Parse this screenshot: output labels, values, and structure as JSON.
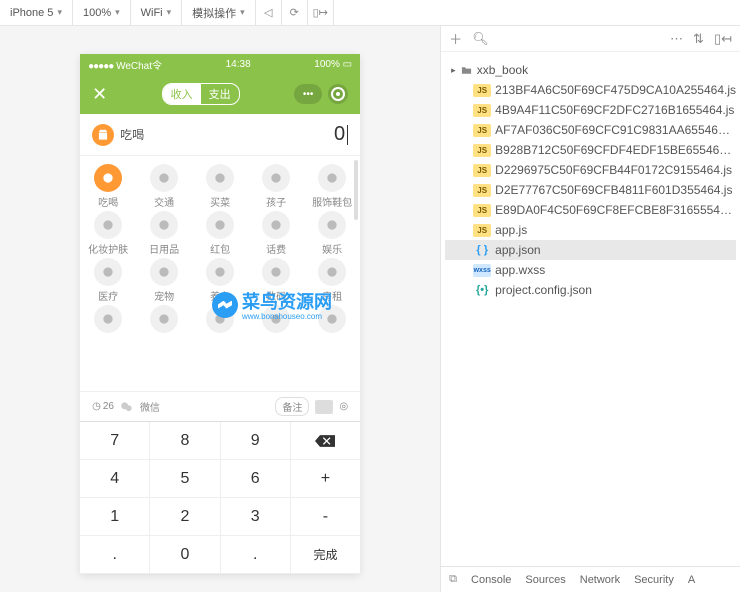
{
  "toolbar": {
    "device": "iPhone 5",
    "zoom": "100%",
    "network": "WiFi",
    "simulate": "模拟操作"
  },
  "phone": {
    "status": {
      "carrier": "WeChat",
      "time": "14:38",
      "battery": "100%"
    },
    "nav": {
      "income": "收入",
      "expense": "支出"
    },
    "input": {
      "category": "吃喝",
      "amount": "0"
    },
    "categories": [
      [
        {
          "l": "吃喝",
          "sel": true
        },
        {
          "l": "交通"
        },
        {
          "l": "买菜"
        },
        {
          "l": "孩子"
        },
        {
          "l": "服饰鞋包"
        }
      ],
      [
        {
          "l": "化妆护肤"
        },
        {
          "l": "日用品"
        },
        {
          "l": "红包"
        },
        {
          "l": "话费"
        },
        {
          "l": "娱乐"
        }
      ],
      [
        {
          "l": "医疗"
        },
        {
          "l": "宠物"
        },
        {
          "l": "养车"
        },
        {
          "l": "数码"
        },
        {
          "l": "房租"
        }
      ],
      [
        {
          "l": ""
        },
        {
          "l": ""
        },
        {
          "l": ""
        },
        {
          "l": ""
        },
        {
          "l": ""
        }
      ]
    ],
    "extra": {
      "date": "26",
      "wechat": "微信",
      "remark": "备注"
    },
    "keypad": [
      [
        "7",
        "8",
        "9",
        "del"
      ],
      [
        "4",
        "5",
        "6",
        "+"
      ],
      [
        "1",
        "2",
        "3",
        "-"
      ],
      [
        ".",
        "0",
        ".",
        "完成"
      ]
    ]
  },
  "watermark": {
    "title": "菜鸟资源网",
    "sub": "www.bonshouseo.com"
  },
  "tree": {
    "root": "xxb_book",
    "files": [
      {
        "t": "js",
        "n": "213BF4A6C50F69CF475D9CA10A255464.js"
      },
      {
        "t": "js",
        "n": "4B9A4F11C50F69CF2DFC2716B1655464.js"
      },
      {
        "t": "js",
        "n": "AF7AF036C50F69CFC91C9831AA65546…"
      },
      {
        "t": "js",
        "n": "B928B712C50F69CFDF4EDF15BE65546…"
      },
      {
        "t": "js",
        "n": "D2296975C50F69CFB44F0172C9155464.js"
      },
      {
        "t": "js",
        "n": "D2E77767C50F69CFB4811F601D355464.js"
      },
      {
        "t": "js",
        "n": "E89DA0F4C50F69CF8EFCBE8F3165554…"
      },
      {
        "t": "js",
        "n": "app.js"
      },
      {
        "t": "json",
        "n": "app.json",
        "sel": true
      },
      {
        "t": "wxss",
        "n": "app.wxss"
      },
      {
        "t": "config",
        "n": "project.config.json"
      }
    ]
  },
  "tabs": [
    "Console",
    "Sources",
    "Network",
    "Security",
    "A"
  ]
}
